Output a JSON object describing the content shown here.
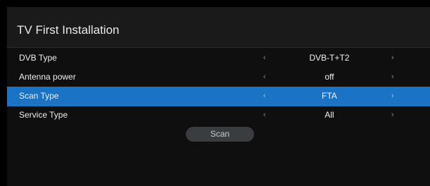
{
  "header": {
    "title": "TV First Installation"
  },
  "settings": [
    {
      "label": "DVB Type",
      "value": "DVB-T+T2",
      "selected": false
    },
    {
      "label": "Antenna power",
      "value": "off",
      "selected": false
    },
    {
      "label": "Scan Type",
      "value": "FTA",
      "selected": true
    },
    {
      "label": "Service Type",
      "value": "All",
      "selected": false
    }
  ],
  "arrows": {
    "left": "‹",
    "right": "›"
  },
  "actions": {
    "scan_label": "Scan"
  },
  "colors": {
    "selection": "#1a73c5",
    "background": "#000000",
    "panel": "#0f0f0f",
    "button": "#3a3c3f"
  }
}
